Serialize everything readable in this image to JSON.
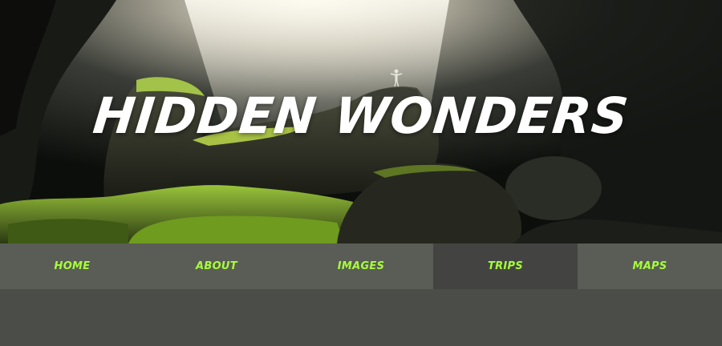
{
  "hero": {
    "title": "HIDDEN WONDERS"
  },
  "nav": {
    "items": [
      {
        "label": "HOME"
      },
      {
        "label": "ABOUT"
      },
      {
        "label": "IMAGES"
      },
      {
        "label": "TRIPS"
      },
      {
        "label": "MAPS"
      }
    ],
    "active_index": 3
  },
  "colors": {
    "nav_text": "#a6ff3a",
    "nav_bg": "#5a5d56",
    "nav_active_bg": "#434442",
    "page_bg": "#4b4d48",
    "title": "#ffffff"
  }
}
